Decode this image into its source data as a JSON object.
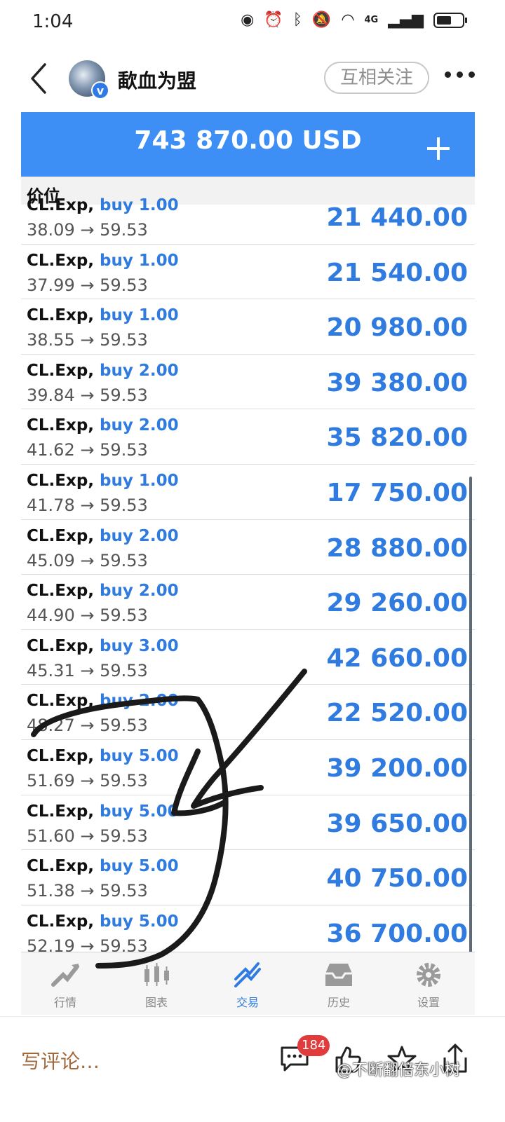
{
  "status_bar": {
    "time": "1:04",
    "network": "4G"
  },
  "header": {
    "author": "歃血为盟",
    "follow_label": "互相关注",
    "verified_badge": "v"
  },
  "embedded_app": {
    "balance": "743 870.00 USD",
    "section_label": "价位",
    "positions": [
      {
        "symbol": "CL.Exp,",
        "kind": "buy 1.00",
        "prices": "38.09 → 59.53",
        "profit": "21 440.00"
      },
      {
        "symbol": "CL.Exp,",
        "kind": "buy 1.00",
        "prices": "37.99 → 59.53",
        "profit": "21 540.00"
      },
      {
        "symbol": "CL.Exp,",
        "kind": "buy 1.00",
        "prices": "38.55 → 59.53",
        "profit": "20 980.00"
      },
      {
        "symbol": "CL.Exp,",
        "kind": "buy 2.00",
        "prices": "39.84 → 59.53",
        "profit": "39 380.00"
      },
      {
        "symbol": "CL.Exp,",
        "kind": "buy 2.00",
        "prices": "41.62 → 59.53",
        "profit": "35 820.00"
      },
      {
        "symbol": "CL.Exp,",
        "kind": "buy 1.00",
        "prices": "41.78 → 59.53",
        "profit": "17 750.00"
      },
      {
        "symbol": "CL.Exp,",
        "kind": "buy 2.00",
        "prices": "45.09 → 59.53",
        "profit": "28 880.00"
      },
      {
        "symbol": "CL.Exp,",
        "kind": "buy 2.00",
        "prices": "44.90 → 59.53",
        "profit": "29 260.00"
      },
      {
        "symbol": "CL.Exp,",
        "kind": "buy 3.00",
        "prices": "45.31 → 59.53",
        "profit": "42 660.00"
      },
      {
        "symbol": "CL.Exp,",
        "kind": "buy 2.00",
        "prices": "48.27 → 59.53",
        "profit": "22 520.00"
      },
      {
        "symbol": "CL.Exp,",
        "kind": "buy 5.00",
        "prices": "51.69 → 59.53",
        "profit": "39 200.00"
      },
      {
        "symbol": "CL.Exp,",
        "kind": "buy 5.00",
        "prices": "51.60 → 59.53",
        "profit": "39 650.00"
      },
      {
        "symbol": "CL.Exp,",
        "kind": "buy 5.00",
        "prices": "51.38 → 59.53",
        "profit": "40 750.00"
      },
      {
        "symbol": "CL.Exp,",
        "kind": "buy 5.00",
        "prices": "52.19 → 59.53",
        "profit": "36 700.00"
      }
    ],
    "tabs": [
      {
        "label": "行情",
        "icon": "quotes-icon"
      },
      {
        "label": "图表",
        "icon": "chart-icon"
      },
      {
        "label": "交易",
        "icon": "trade-icon",
        "active": true
      },
      {
        "label": "历史",
        "icon": "history-icon"
      },
      {
        "label": "设置",
        "icon": "settings-icon"
      }
    ],
    "accent_color": "#3d8ef5",
    "profit_color": "#2f7be0"
  },
  "bottom_bar": {
    "write_comment": "写评论…",
    "comment_count": "184",
    "watermark": "@不断翻倍东小树"
  },
  "colors": {
    "badge": "#e23b3b",
    "write_comment": "#a2693c"
  }
}
